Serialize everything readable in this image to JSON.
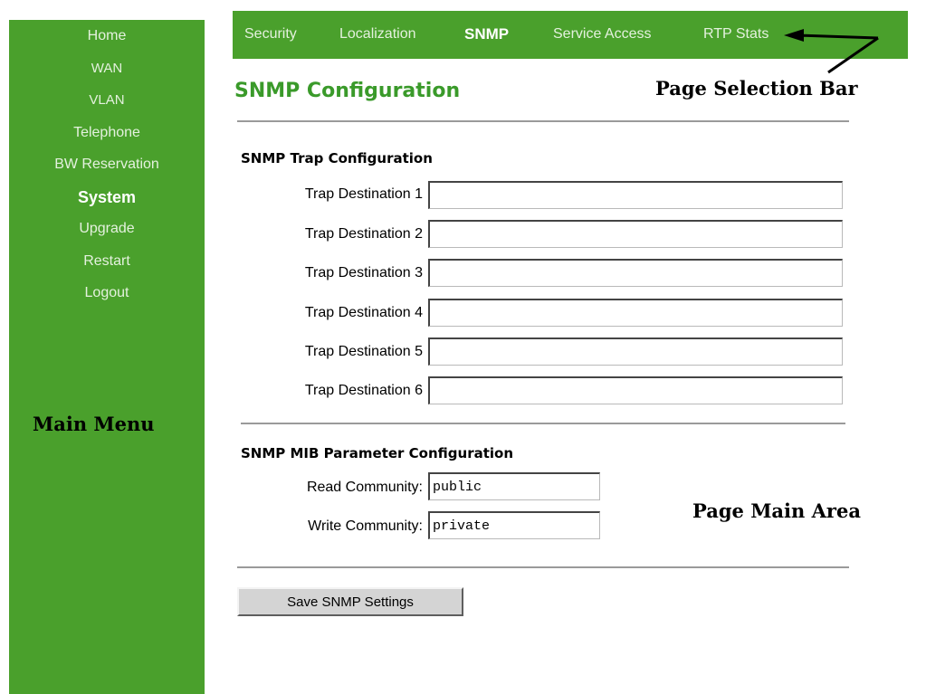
{
  "sidebar": {
    "items": [
      {
        "label": "Home"
      },
      {
        "label": "WAN"
      },
      {
        "label": "VLAN"
      },
      {
        "label": "Telephone"
      },
      {
        "label": "BW Reservation"
      },
      {
        "label": "System"
      },
      {
        "label": "Upgrade"
      },
      {
        "label": "Restart"
      },
      {
        "label": "Logout"
      }
    ],
    "active": "System"
  },
  "topbar": {
    "tabs": [
      {
        "label": "Security"
      },
      {
        "label": "Localization"
      },
      {
        "label": "SNMP"
      },
      {
        "label": "Service Access"
      },
      {
        "label": "RTP Stats"
      }
    ],
    "active": "SNMP"
  },
  "annotations": {
    "page_selection_bar": "Page Selection Bar",
    "main_menu": "Main Menu",
    "page_main_area": "Page Main Area"
  },
  "main": {
    "title": "SNMP Configuration",
    "trap_section": {
      "title": "SNMP Trap Configuration",
      "fields": [
        {
          "label": "Trap Destination 1",
          "value": ""
        },
        {
          "label": "Trap Destination 2",
          "value": ""
        },
        {
          "label": "Trap Destination 3",
          "value": ""
        },
        {
          "label": "Trap Destination 4",
          "value": ""
        },
        {
          "label": "Trap Destination 5",
          "value": ""
        },
        {
          "label": "Trap Destination 6",
          "value": ""
        }
      ]
    },
    "mib_section": {
      "title": "SNMP MIB Parameter Configuration",
      "read_label": "Read Community:",
      "read_value": "public",
      "write_label": "Write Community:",
      "write_value": "private"
    },
    "save_label": "Save SNMP Settings"
  },
  "colors": {
    "brand_green": "#4aa02c",
    "title_green": "#3a9a2a"
  }
}
